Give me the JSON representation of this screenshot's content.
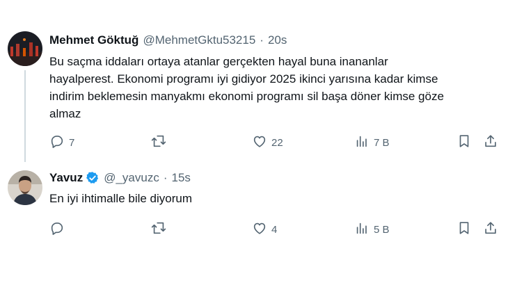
{
  "tweets": [
    {
      "name": "Mehmet Göktuğ",
      "handle": "@MehmetGktu53215",
      "separator": "·",
      "time": "20s",
      "verified": false,
      "text_lines": [
        "Bu saçma iddaları ortaya atanlar gerçekten hayal buna inananlar",
        "hayalperest. Ekonomi programı iyi gidiyor 2025 ikinci yarısına kadar kimse",
        "indirim beklemesin manyakmı ekonomi programı sil başa döner kimse göze",
        "almaz"
      ],
      "replies": "7",
      "retweets": "",
      "likes": "22",
      "views": "7 B"
    },
    {
      "name": "Yavuz",
      "handle": "@_yavuzc",
      "separator": "·",
      "time": "15s",
      "verified": true,
      "text_lines": [
        "En iyi ihtimalle bile diyorum"
      ],
      "replies": "",
      "retweets": "",
      "likes": "4",
      "views": "5 B"
    }
  ],
  "icons": {
    "reply": "reply-icon",
    "retweet": "retweet-icon",
    "like": "heart-icon",
    "views": "views-chart-icon",
    "bookmark": "bookmark-icon",
    "share": "share-icon",
    "verified": "verified-badge-icon"
  },
  "colors": {
    "text": "#0f1419",
    "secondary": "#536471",
    "verified": "#1d9bf0",
    "thread_line": "#cfd9de"
  }
}
